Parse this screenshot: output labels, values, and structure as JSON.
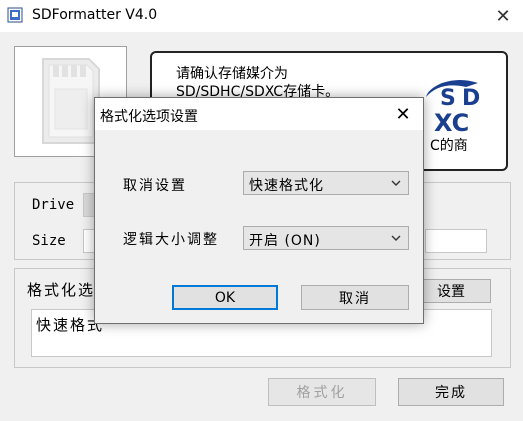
{
  "window": {
    "title": "SDFormatter V4.0",
    "close_symbol": "✕",
    "icon": "sd-card-app-icon"
  },
  "info": {
    "line1": "请确认存储媒介为",
    "line2": "SD/SDHC/SDXC存储卡。",
    "line3_trail": "C的商",
    "logo_text": "SDXC"
  },
  "drive": {
    "drive_label": "Drive",
    "size_label": "Size"
  },
  "format_option": {
    "label": "格式化选",
    "settings_button": "设置",
    "current_value": "快速格式"
  },
  "buttons": {
    "format": "格式化",
    "finish": "完成"
  },
  "dialog": {
    "title": "格式化选项设置",
    "close_symbol": "✕",
    "cancel_setting_label": "取消设置",
    "cancel_setting_value": "快速格式化",
    "logical_size_label": "逻辑大小调整",
    "logical_size_value": "开启 (ON)",
    "ok": "OK",
    "cancel": "取消"
  },
  "colors": {
    "accent": "#0078d7",
    "window_bg": "#f0f0f0"
  }
}
